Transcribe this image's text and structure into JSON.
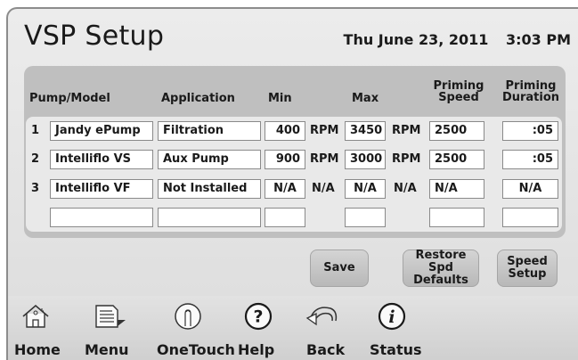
{
  "header": {
    "title": "VSP Setup",
    "date": "Thu June 23, 2011",
    "time": "3:03 PM"
  },
  "table": {
    "columns": {
      "pump_model": "Pump/Model",
      "application": "Application",
      "min": "Min",
      "max": "Max",
      "priming_speed_1": "Priming",
      "priming_speed_2": "Speed",
      "priming_duration_1": "Priming",
      "priming_duration_2": "Duration"
    },
    "rows": [
      {
        "num": "1",
        "model": "Jandy ePump",
        "application": "Filtration",
        "min": "400",
        "min_unit": "RPM",
        "max": "3450",
        "max_unit": "RPM",
        "priming_speed": "2500",
        "priming_duration": ":05"
      },
      {
        "num": "2",
        "model": "Intelliflo VS",
        "application": "Aux Pump",
        "min": "900",
        "min_unit": "RPM",
        "max": "3000",
        "max_unit": "RPM",
        "priming_speed": "2500",
        "priming_duration": ":05"
      },
      {
        "num": "3",
        "model": "Intelliflo VF",
        "application": "Not Installed",
        "min": "N/A",
        "min_unit": "N/A",
        "max": "N/A",
        "max_unit": "N/A",
        "priming_speed": "N/A",
        "priming_duration": "N/A"
      },
      {
        "num": "",
        "model": "",
        "application": "",
        "min": "",
        "min_unit": "",
        "max": "",
        "max_unit": "",
        "priming_speed": "",
        "priming_duration": ""
      }
    ]
  },
  "buttons": {
    "save": "Save",
    "restore_1": "Restore Spd",
    "restore_2": "Defaults",
    "speed_1": "Speed",
    "speed_2": "Setup"
  },
  "nav": {
    "home": "Home",
    "menu": "Menu",
    "onetouch": "OneTouch",
    "help": "Help",
    "back": "Back",
    "status": "Status"
  },
  "icons": [
    "home-icon",
    "menu-icon",
    "onetouch-icon",
    "help-icon",
    "back-icon",
    "status-icon"
  ]
}
